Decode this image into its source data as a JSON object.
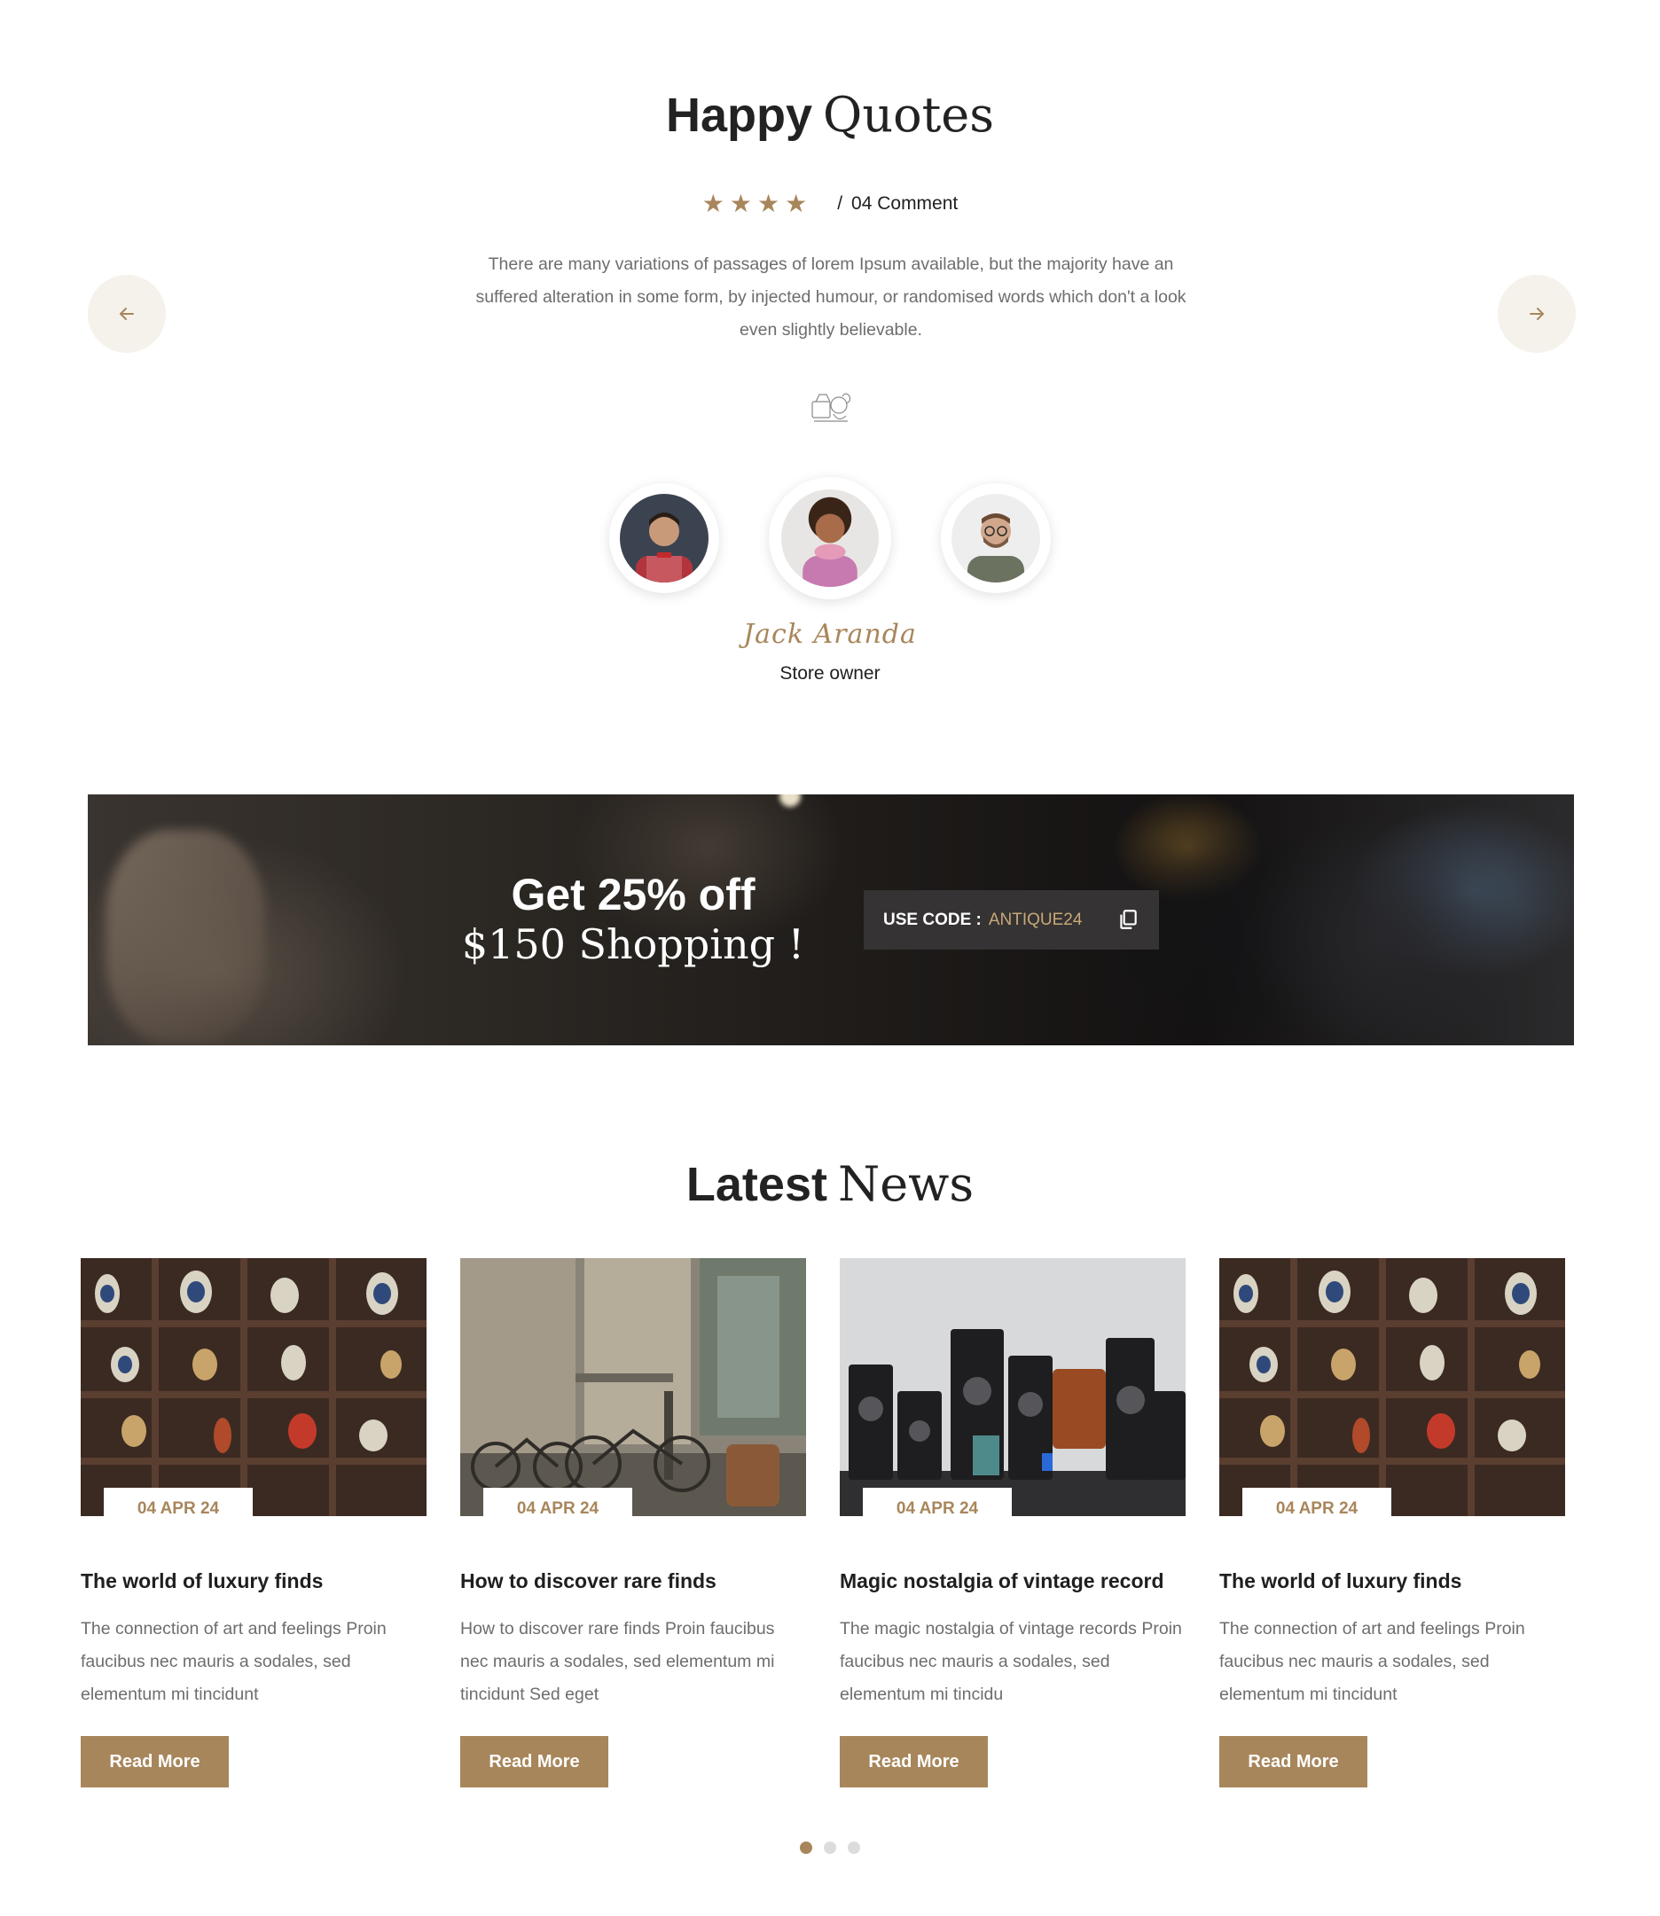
{
  "colors": {
    "accent": "#a8865b",
    "text": "#1f1f1f",
    "muted": "#6d6d6d",
    "arrow_bg": "#f5f2ec"
  },
  "testimonials": {
    "title_bold": "Happy",
    "title_light": "Quotes",
    "rating": {
      "stars": 4,
      "separator": "/",
      "comment_count": "04 Comment"
    },
    "quote": "There are many variations of passages of lorem Ipsum available, but the majority have an suffered alteration in some form, by injected humour, or randomised words which don't a look even slightly believable.",
    "prev_icon": "arrow-left-icon",
    "next_icon": "arrow-right-icon",
    "quote_icon": "quote-illustration-icon",
    "avatars": [
      {
        "name": "avatar-man-bowtie",
        "active": false
      },
      {
        "name": "avatar-woman-pink",
        "active": true
      },
      {
        "name": "avatar-man-glasses",
        "active": false
      }
    ],
    "signature": "Jack Aranda",
    "role": "Store owner"
  },
  "promo": {
    "line1": "Get 25% off",
    "line2": "$150 Shopping !",
    "code_label": "USE CODE :",
    "code_value": "ANTIQUE24",
    "copy_icon": "copy-icon"
  },
  "news": {
    "title_bold": "Latest",
    "title_light": "News",
    "read_more_label": "Read More",
    "posts": [
      {
        "date": "04 APR 24",
        "title": "The world of luxury finds",
        "excerpt": "The connection of art and feelings Proin faucibus nec mauris a sodales, sed elementum mi tincidunt",
        "image": "cabinet-of-antique-vases"
      },
      {
        "date": "04 APR 24",
        "title": "How to discover rare finds",
        "excerpt": "How to discover rare finds Proin faucibus nec mauris a sodales, sed elementum mi tincidunt Sed eget",
        "image": "old-street-with-bicycle"
      },
      {
        "date": "04 APR 24",
        "title": "Magic nostalgia of vintage record",
        "excerpt": "The magic nostalgia of vintage records Proin faucibus nec mauris a sodales, sed elementum mi tincidu",
        "image": "vintage-cameras"
      },
      {
        "date": "04 APR 24",
        "title": "The world of luxury finds",
        "excerpt": "The connection of art and feelings Proin faucibus nec mauris a sodales, sed elementum mi tincidunt",
        "image": "cabinet-of-antique-vases"
      }
    ],
    "pagination": {
      "count": 3,
      "active": 0
    }
  }
}
